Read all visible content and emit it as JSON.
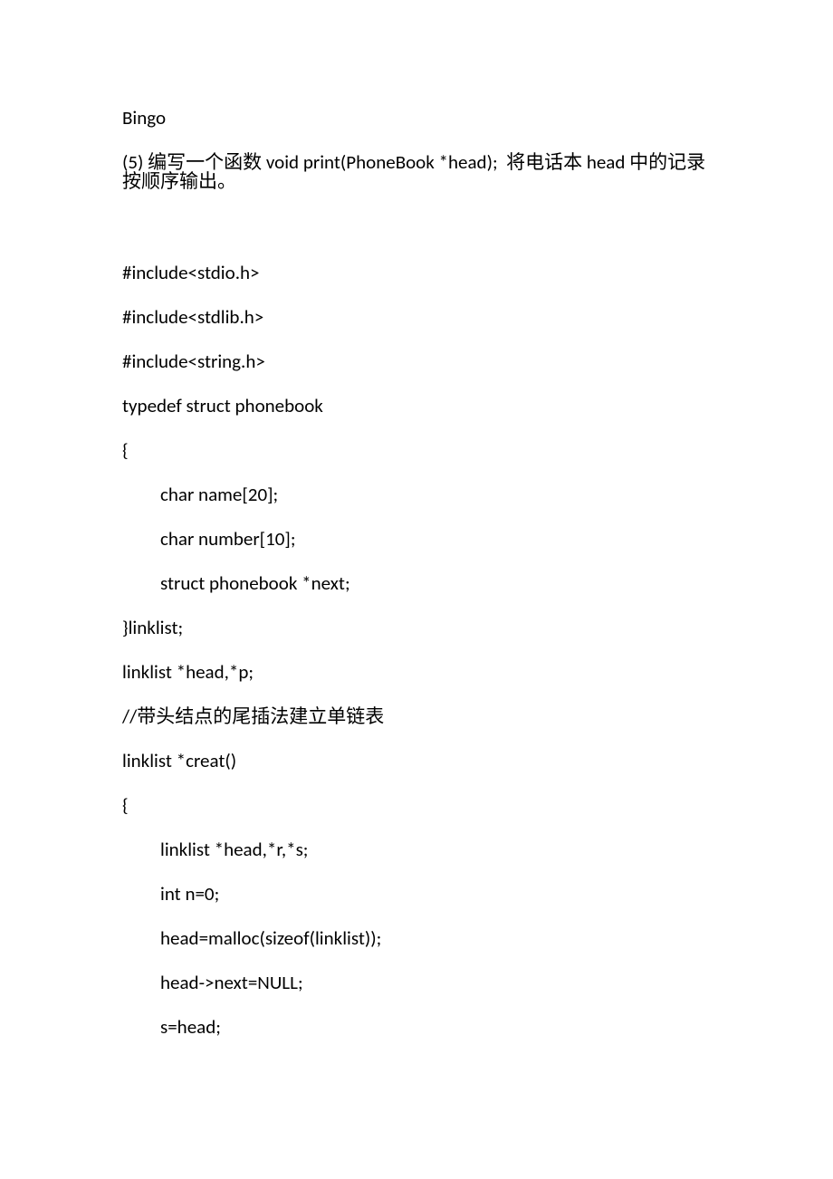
{
  "lines": [
    {
      "text": "Bingo",
      "indent": false,
      "blank": false
    },
    {
      "text": "(5) 编写一个函数 void print(PhoneBook *head);  将电话本 head 中的记录按顺序输出。",
      "indent": false,
      "blank": false
    },
    {
      "text": "",
      "indent": false,
      "blank": true
    },
    {
      "text": "#include<stdio.h>",
      "indent": false,
      "blank": false
    },
    {
      "text": "#include<stdlib.h>",
      "indent": false,
      "blank": false
    },
    {
      "text": "#include<string.h>",
      "indent": false,
      "blank": false
    },
    {
      "text": "typedef struct phonebook",
      "indent": false,
      "blank": false
    },
    {
      "text": "{",
      "indent": false,
      "blank": false
    },
    {
      "text": "char name[20];",
      "indent": true,
      "blank": false
    },
    {
      "text": "char number[10];",
      "indent": true,
      "blank": false
    },
    {
      "text": "struct phonebook *next;",
      "indent": true,
      "blank": false
    },
    {
      "text": "}linklist;",
      "indent": false,
      "blank": false
    },
    {
      "text": "linklist *head,*p;",
      "indent": false,
      "blank": false
    },
    {
      "text": "//带头结点的尾插法建立单链表",
      "indent": false,
      "blank": false
    },
    {
      "text": "linklist *creat()",
      "indent": false,
      "blank": false
    },
    {
      "text": "{",
      "indent": false,
      "blank": false
    },
    {
      "text": "linklist *head,*r,*s;",
      "indent": true,
      "blank": false
    },
    {
      "text": "int n=0;",
      "indent": true,
      "blank": false
    },
    {
      "text": "head=malloc(sizeof(linklist));",
      "indent": true,
      "blank": false
    },
    {
      "text": "head->next=NULL;",
      "indent": true,
      "blank": false
    },
    {
      "text": "s=head;",
      "indent": true,
      "blank": false
    }
  ]
}
